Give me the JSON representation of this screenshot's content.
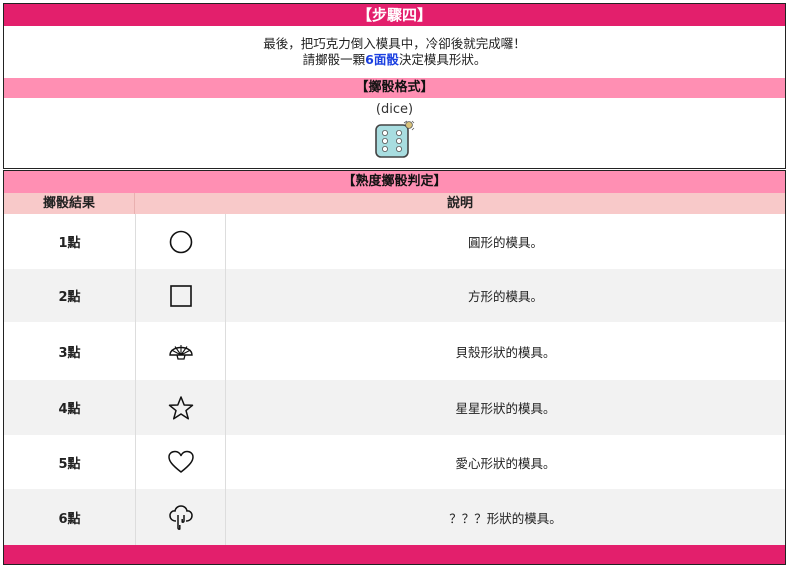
{
  "step": {
    "title": "【步驟四】"
  },
  "intro": {
    "line1": "最後，把巧克力倒入模具中，冷卻後就完成囉！",
    "line2_prefix": "請擲骰一顆",
    "line2_highlight": "6面骰",
    "line2_suffix": "決定模具形狀。"
  },
  "dice_format": {
    "header": "【擲骰格式】",
    "command": "(dice)",
    "icon": "dice-icon"
  },
  "judge": {
    "header": "【熟度擲骰判定】",
    "col_result": "擲骰結果",
    "col_desc": "說明",
    "rows": [
      {
        "result": "1點",
        "icon": "circle-icon",
        "desc": "圓形的模具。"
      },
      {
        "result": "2點",
        "icon": "square-icon",
        "desc": "方形的模具。"
      },
      {
        "result": "3點",
        "icon": "shell-icon",
        "desc": "貝殼形狀的模具。"
      },
      {
        "result": "4點",
        "icon": "star-icon",
        "desc": "星星形狀的模具。"
      },
      {
        "result": "5點",
        "icon": "heart-icon",
        "desc": "愛心形狀的模具。"
      },
      {
        "result": "6點",
        "icon": "mystery-icon",
        "desc": "？？？形狀的模具。"
      }
    ]
  },
  "colors": {
    "accent": "#e31f6c",
    "pink_header": "#ff8fb3",
    "table_header": "#f8c9c9",
    "highlight_text": "#1a3fe0"
  }
}
